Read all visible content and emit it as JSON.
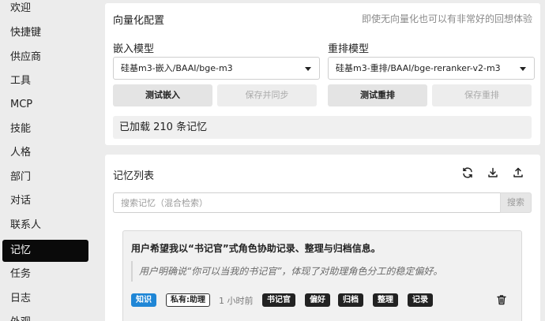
{
  "sidebar": {
    "items": [
      {
        "label": "欢迎"
      },
      {
        "label": "快捷键"
      },
      {
        "label": "供应商"
      },
      {
        "label": "工具"
      },
      {
        "label": "MCP"
      },
      {
        "label": "技能"
      },
      {
        "label": "人格"
      },
      {
        "label": "部门"
      },
      {
        "label": "对话"
      },
      {
        "label": "联系人"
      },
      {
        "label": "记忆",
        "active": true
      },
      {
        "label": "任务"
      },
      {
        "label": "日志"
      },
      {
        "label": "外观"
      }
    ]
  },
  "vector_config": {
    "title": "向量化配置",
    "hint": "即使无向量化也可以有非常好的回想体验",
    "embed_label": "嵌入模型",
    "embed_value": "硅基m3-嵌入/BAAI/bge-m3",
    "rerank_label": "重排模型",
    "rerank_value": "硅基m3-重排/BAAI/bge-reranker-v2-m3",
    "btn_test_embed": "测试嵌入",
    "btn_save_sync": "保存并同步",
    "btn_test_rerank": "测试重排",
    "btn_save_rerank": "保存重排",
    "status": "已加载 210 条记忆"
  },
  "memory_list": {
    "title": "记忆列表",
    "icons": [
      "refresh-icon",
      "download-icon",
      "upload-icon"
    ],
    "search_placeholder": "搜索记忆（混合检索）",
    "search_button": "搜索",
    "items": [
      {
        "title": "用户希望我以“书记官”式角色协助记录、整理与归档信息。",
        "quote": "用户明确说“你可以当我的书记官”，体现了对助理角色分工的稳定偏好。",
        "type_tag": "知识",
        "scope_tag": "私有:助理",
        "time": "1 小时前",
        "keywords": [
          "书记官",
          "偏好",
          "归档",
          "整理",
          "记录"
        ]
      }
    ]
  },
  "colors": {
    "active_nav": "#0a0a0a",
    "tag_blue": "#1f86d6",
    "background": "#ececec"
  }
}
